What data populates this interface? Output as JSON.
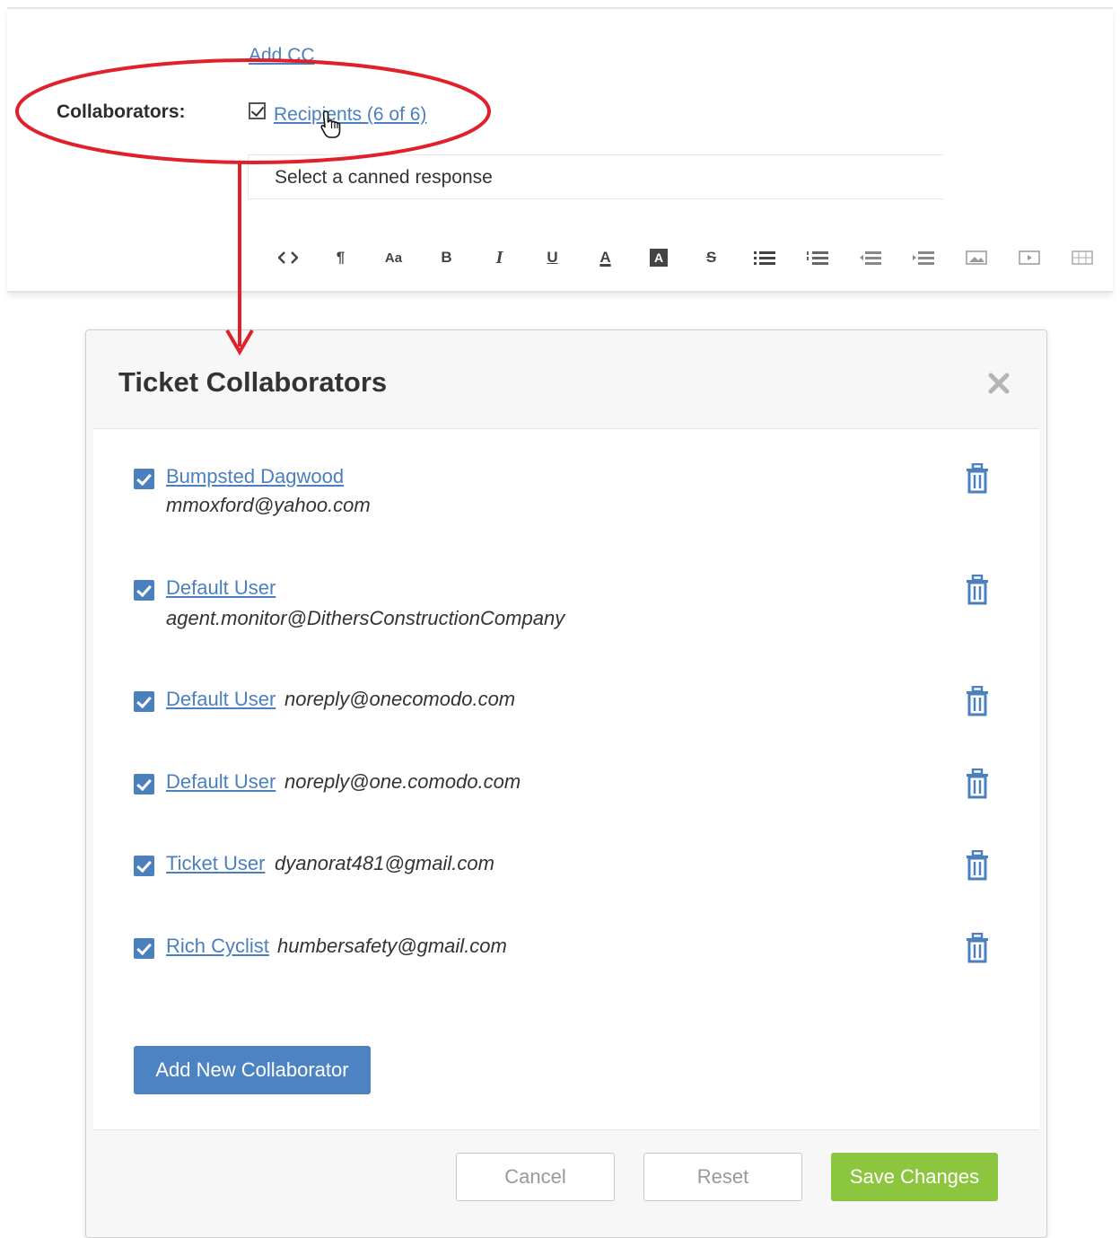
{
  "form": {
    "add_cc": "Add CC",
    "collaborators_label": "Collaborators:",
    "recipients_link": "Recipients (6 of 6)",
    "canned_response_placeholder": "Select a canned response"
  },
  "toolbar": {
    "items": [
      {
        "icon": "code-view-icon",
        "glyph": "<>"
      },
      {
        "icon": "paragraph-icon",
        "glyph": "¶"
      },
      {
        "icon": "font-size-icon",
        "glyph": "Aa"
      },
      {
        "icon": "bold-icon",
        "glyph": "B"
      },
      {
        "icon": "italic-icon",
        "glyph": "I"
      },
      {
        "icon": "underline-icon",
        "glyph": "U"
      },
      {
        "icon": "font-color-icon",
        "glyph": "A"
      },
      {
        "icon": "background-color-icon",
        "glyph": "A"
      },
      {
        "icon": "strikethrough-icon",
        "glyph": "S"
      },
      {
        "icon": "bullet-list-icon",
        "glyph": ""
      },
      {
        "icon": "numbered-list-icon",
        "glyph": ""
      },
      {
        "icon": "outdent-icon",
        "glyph": ""
      },
      {
        "icon": "indent-icon",
        "glyph": ""
      },
      {
        "icon": "insert-image-icon",
        "glyph": ""
      },
      {
        "icon": "insert-video-icon",
        "glyph": ""
      },
      {
        "icon": "insert-table-icon",
        "glyph": ""
      }
    ]
  },
  "modal": {
    "title": "Ticket Collaborators",
    "collaborators": [
      {
        "name": "Bumpsted Dagwood",
        "email": "mmoxford@yahoo.com",
        "checked": true
      },
      {
        "name": "Default User",
        "email": "agent.monitor@DithersConstructionCompany",
        "checked": true
      },
      {
        "name": "Default User",
        "email": "noreply@onecomodo.com",
        "checked": true
      },
      {
        "name": "Default User",
        "email": "noreply@one.comodo.com",
        "checked": true
      },
      {
        "name": "Ticket User",
        "email": "dyanorat481@gmail.com",
        "checked": true
      },
      {
        "name": "Rich Cyclist",
        "email": "humbersafety@gmail.com",
        "checked": true
      }
    ],
    "add_button": "Add New Collaborator",
    "cancel_button": "Cancel",
    "reset_button": "Reset",
    "save_button": "Save Changes"
  },
  "colors": {
    "link": "#4a7fc0",
    "checkbox": "#4a80be",
    "primary_button": "#4d82c3",
    "save_button": "#8cc63f",
    "annotation_red": "#e0202a"
  }
}
